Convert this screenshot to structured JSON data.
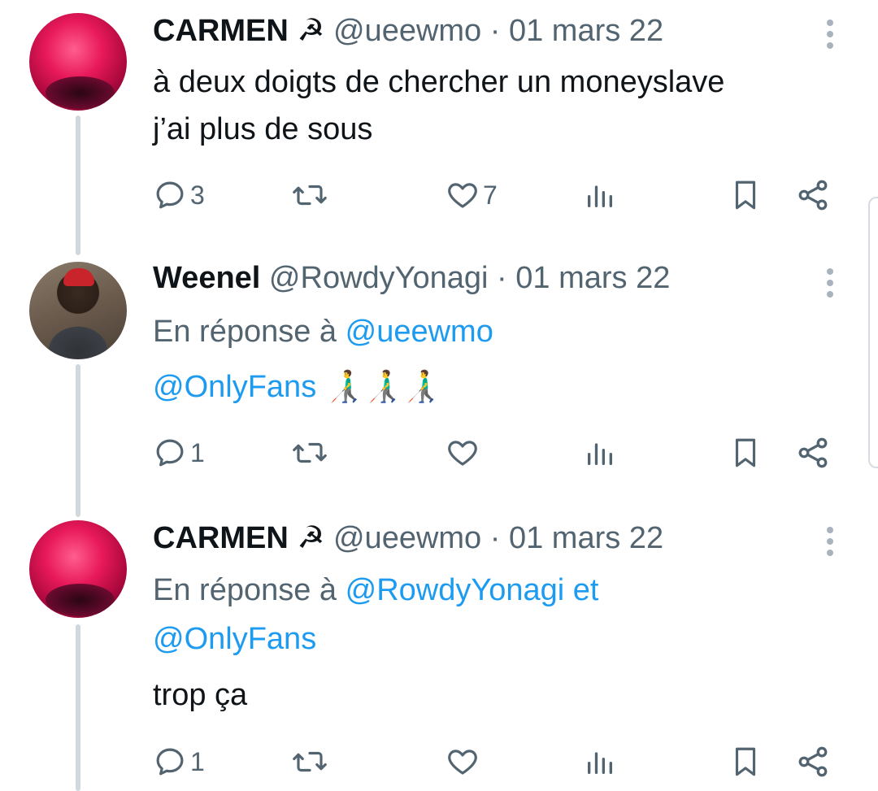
{
  "tweets": [
    {
      "name": "CARMEN",
      "flag": "☭",
      "handle": "@ueewmo",
      "date": "01 mars 22",
      "text_lines": [
        "à deux doigts de chercher un moneyslave",
        "j’ai plus de sous"
      ],
      "reply_count": "3",
      "like_count": "7",
      "avatar": "carmen-avatar"
    },
    {
      "name": "Weenel",
      "handle": "@RowdyYonagi",
      "date": "01 mars 22",
      "reply_prefix": "En réponse à",
      "reply_to": "@ueewmo",
      "mention": "@OnlyFans",
      "emoji": "👨‍🦯👨‍🦯👨‍🦯",
      "reply_count": "1",
      "like_count": "",
      "avatar": "weenel-avatar"
    },
    {
      "name": "CARMEN",
      "flag": "☭",
      "handle": "@ueewmo",
      "date": "01 mars 22",
      "reply_prefix": "En réponse à",
      "reply_to": "@RowdyYonagi et",
      "reply_to_2": "@OnlyFans",
      "text": "trop ça",
      "reply_count": "1",
      "like_count": "",
      "avatar": "carmen-avatar"
    }
  ],
  "separator": "·",
  "icons": [
    "reply-icon",
    "retweet-icon",
    "like-icon",
    "views-icon",
    "bookmark-icon",
    "share-icon",
    "more-icon"
  ],
  "colors": {
    "text": "#0f1419",
    "muted": "#536471",
    "link": "#1d9bf0",
    "thread": "#cfd9de"
  }
}
